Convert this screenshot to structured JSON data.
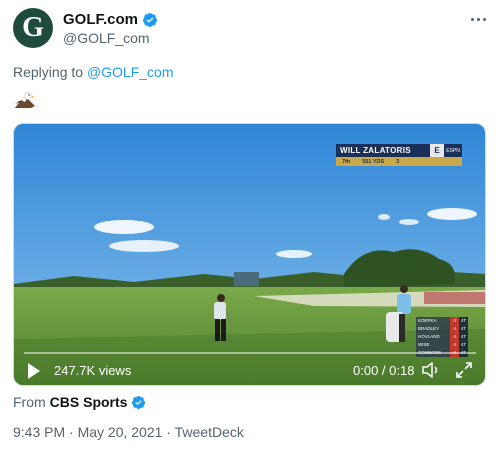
{
  "account": {
    "avatar_letter": "G",
    "display_name": "GOLF.com",
    "handle": "@GOLF_com"
  },
  "reply": {
    "prefix": "Replying to",
    "target": "@GOLF_com"
  },
  "emoji": "eagle-emoji",
  "video": {
    "broadcast_graphic": {
      "player": "WILL ZALATORIS",
      "score": "E",
      "network": "ESPN",
      "hole": "7th",
      "yards": "551 YDS",
      "par": "3"
    },
    "leaderboard": [
      {
        "name": "KOEPKA",
        "score": "-2",
        "thru": "4T"
      },
      {
        "name": "BRADLEY",
        "score": "-1",
        "thru": "4T"
      },
      {
        "name": "HOVLAND",
        "score": "-1",
        "thru": "4T"
      },
      {
        "name": "WISE",
        "score": "-1",
        "thru": "4T"
      },
      {
        "name": "CONNORS",
        "score": "-1",
        "thru": "4T"
      }
    ],
    "views": "247.7K views",
    "time": "0:00 / 0:18"
  },
  "source": {
    "prefix": "From",
    "name": "CBS Sports"
  },
  "meta": "9:43 PM · May 20, 2021 · TweetDeck",
  "colors": {
    "link": "#1d9bf0",
    "verified": "#1d9bf0",
    "muted": "#536471",
    "avatar_bg": "#1f4a3e"
  }
}
